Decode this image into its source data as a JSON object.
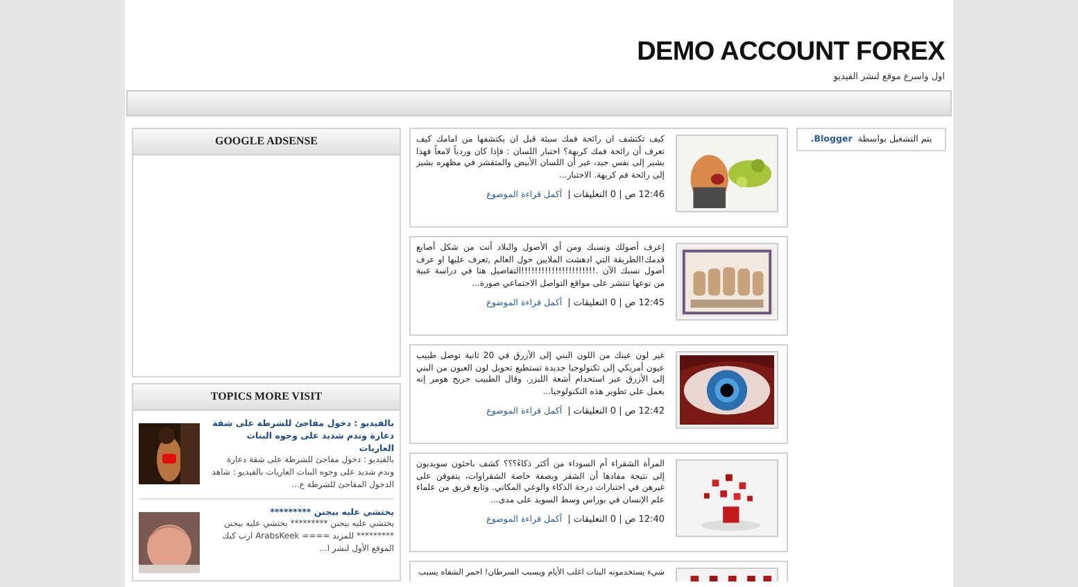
{
  "header": {
    "title": "DEMO ACCOUNT FOREX",
    "description": "اول واسرع موقع لنشر الفيديو"
  },
  "left_sidebar": {
    "adsense": {
      "title": "GOOGLE ADSENSE"
    },
    "topics": {
      "title": "TOPICS MORE VISIT",
      "items": [
        {
          "title": "بالفيديو : دخول مفاجئ للشرطة على شقة دعارة وندم شديد على وجوه البنات العاريات",
          "snippet": "بالفيديو : دخول مفاجئ للشرطة على شقة دعارة وندم شديد على وجوه البنات العاريات بالفيديو : شاهد الدخول المفاجئ للشرطة ع...",
          "kind": "picture"
        },
        {
          "title": "يختشي عليه بيجنن *********",
          "snippet": "يختشي عليه بيجنن ********* يختشي عليه بيجنن ********* للمزيد ==== ArabsKeek ارب كيك الموقع الأول لنشر ا...",
          "kind": "picture"
        }
      ]
    }
  },
  "posts": [
    {
      "snippet": "كيف تكتشف ان رائحة فمك سيئة قبل ان يكتشفها من امامك كيف تعرف أن رائحة فمك كريهة؟ اختبار اللسان : فإذا كان وردياً لامعاً فهذا يشير إلى نفس جيد، غير أن اللسان الأبيض والمتقشر في مظهره يشير إلى رائحة فم كريهة. الاختبار...",
      "meta": "12:46 ص | 0 التعليقات |",
      "link": "أكمل قراءة الموضوع",
      "kind": "picture"
    },
    {
      "snippet": "إعرف أصولك ونسبك ومن أي الأصول والبلاد أنت من شكل أصابع قدمك!الطريقة التي ادهشت الملايين حول العالم ,تعرف عليها او عرف أصول نسبك الآن .!!!!!!!!!!!!!!!!!!!!!!التفاصيل هنا في دراسة غبية من نوعها تنتشر على مواقع التواصل الاجتماعي صورة...",
      "meta": "12:45 ص | 0 التعليقات |",
      "link": "أكمل قراءة الموضوع",
      "kind": "picture"
    },
    {
      "snippet": "غير لون عينك من اللون البني إلى الأزرق في 20 ثانية توصل طبيب عيون أمريكي إلى تكنولوجيا جديدة تستطيع تحويل لون العيون من البني إلى الأزرق عبر استخدام أشعة الليزر. وقال الطبيب جريج هومر إنه يعمل على تطوير هذه التكنولوجيا...",
      "meta": "12:42 ص | 0 التعليقات |",
      "link": "أكمل قراءة الموضوع",
      "kind": "picture"
    },
    {
      "snippet": "المرأة الشقراء أم السوداء من أكثر ذكاءً؟؟؟ كشف باحثون سويديون إلى نتيجة مفادها أن الشقر وبصفة خاصة الشقراوات، يتفوقن على غيرهن في اختبارات درجة الذكاء والوعي المكاني. وتابع فريق من علماء علم الإنسان في بوراس وسط السويد على مدى...",
      "meta": "12:40 ص | 0 التعليقات |",
      "link": "أكمل قراءة الموضوع",
      "kind": "picture"
    },
    {
      "snippet": "شيء يستخدمونه البنات اغلب الأيام ويسبب السرطان! احمر الشفاه يسبب",
      "kind": "picture"
    }
  ],
  "right_sidebar": {
    "powered_by": "يتم التشغيل بواسطة",
    "link": "Blogger."
  }
}
